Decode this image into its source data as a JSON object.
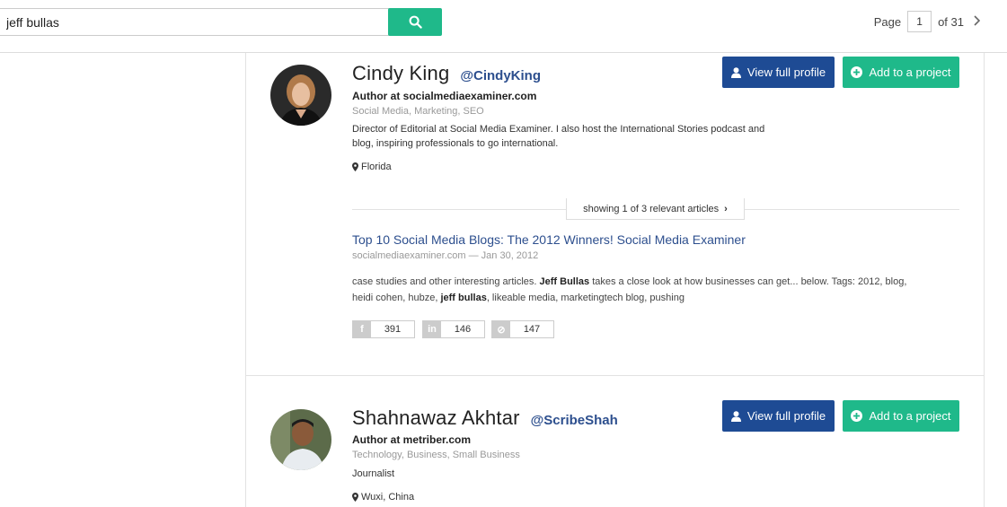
{
  "search": {
    "value": "jeff bullas",
    "placeholder": ""
  },
  "pagination": {
    "page_label": "Page",
    "current": "1",
    "of_label": "of 31"
  },
  "actions": {
    "view_profile": "View full profile",
    "add_project": "Add to a project"
  },
  "authors": [
    {
      "name": "Cindy King",
      "handle": "@CindyKing",
      "role": "Author at socialmediaexaminer.com",
      "topics": "Social Media, Marketing, SEO",
      "bio": "Director of Editorial at Social Media Examiner. I also host the International Stories podcast and blog, inspiring professionals to go international.",
      "location": "Florida",
      "showing": "showing 1 of 3 relevant articles",
      "article": {
        "title": "Top 10 Social Media Blogs: The 2012 Winners! Social Media Examiner",
        "meta": "socialmediaexaminer.com — Jan 30, 2012",
        "snippet_parts": [
          "case studies and other interesting articles. ",
          "Jeff Bullas",
          " takes a close look at how businesses can get... below. Tags: 2012, blog, heidi cohen, hubze, ",
          "jeff bullas",
          ", likeable media, marketingtech blog, pushing"
        ]
      },
      "shares": {
        "facebook": "391",
        "linkedin": "146",
        "pinterest": "147"
      }
    },
    {
      "name": "Shahnawaz Akhtar",
      "handle": "@ScribeShah",
      "role": "Author at metriber.com",
      "topics": "Technology, Business, Small Business",
      "bio": "Journalist",
      "location": "Wuxi, China"
    }
  ],
  "colors": {
    "accent_green": "#1fb98a",
    "accent_blue": "#1e4b94",
    "link": "#2d4f8e"
  },
  "icons": [
    "search-icon",
    "chevron-right-icon",
    "user-icon",
    "plus-circle-icon",
    "map-pin-icon",
    "facebook-icon",
    "linkedin-icon",
    "pinterest-icon"
  ]
}
